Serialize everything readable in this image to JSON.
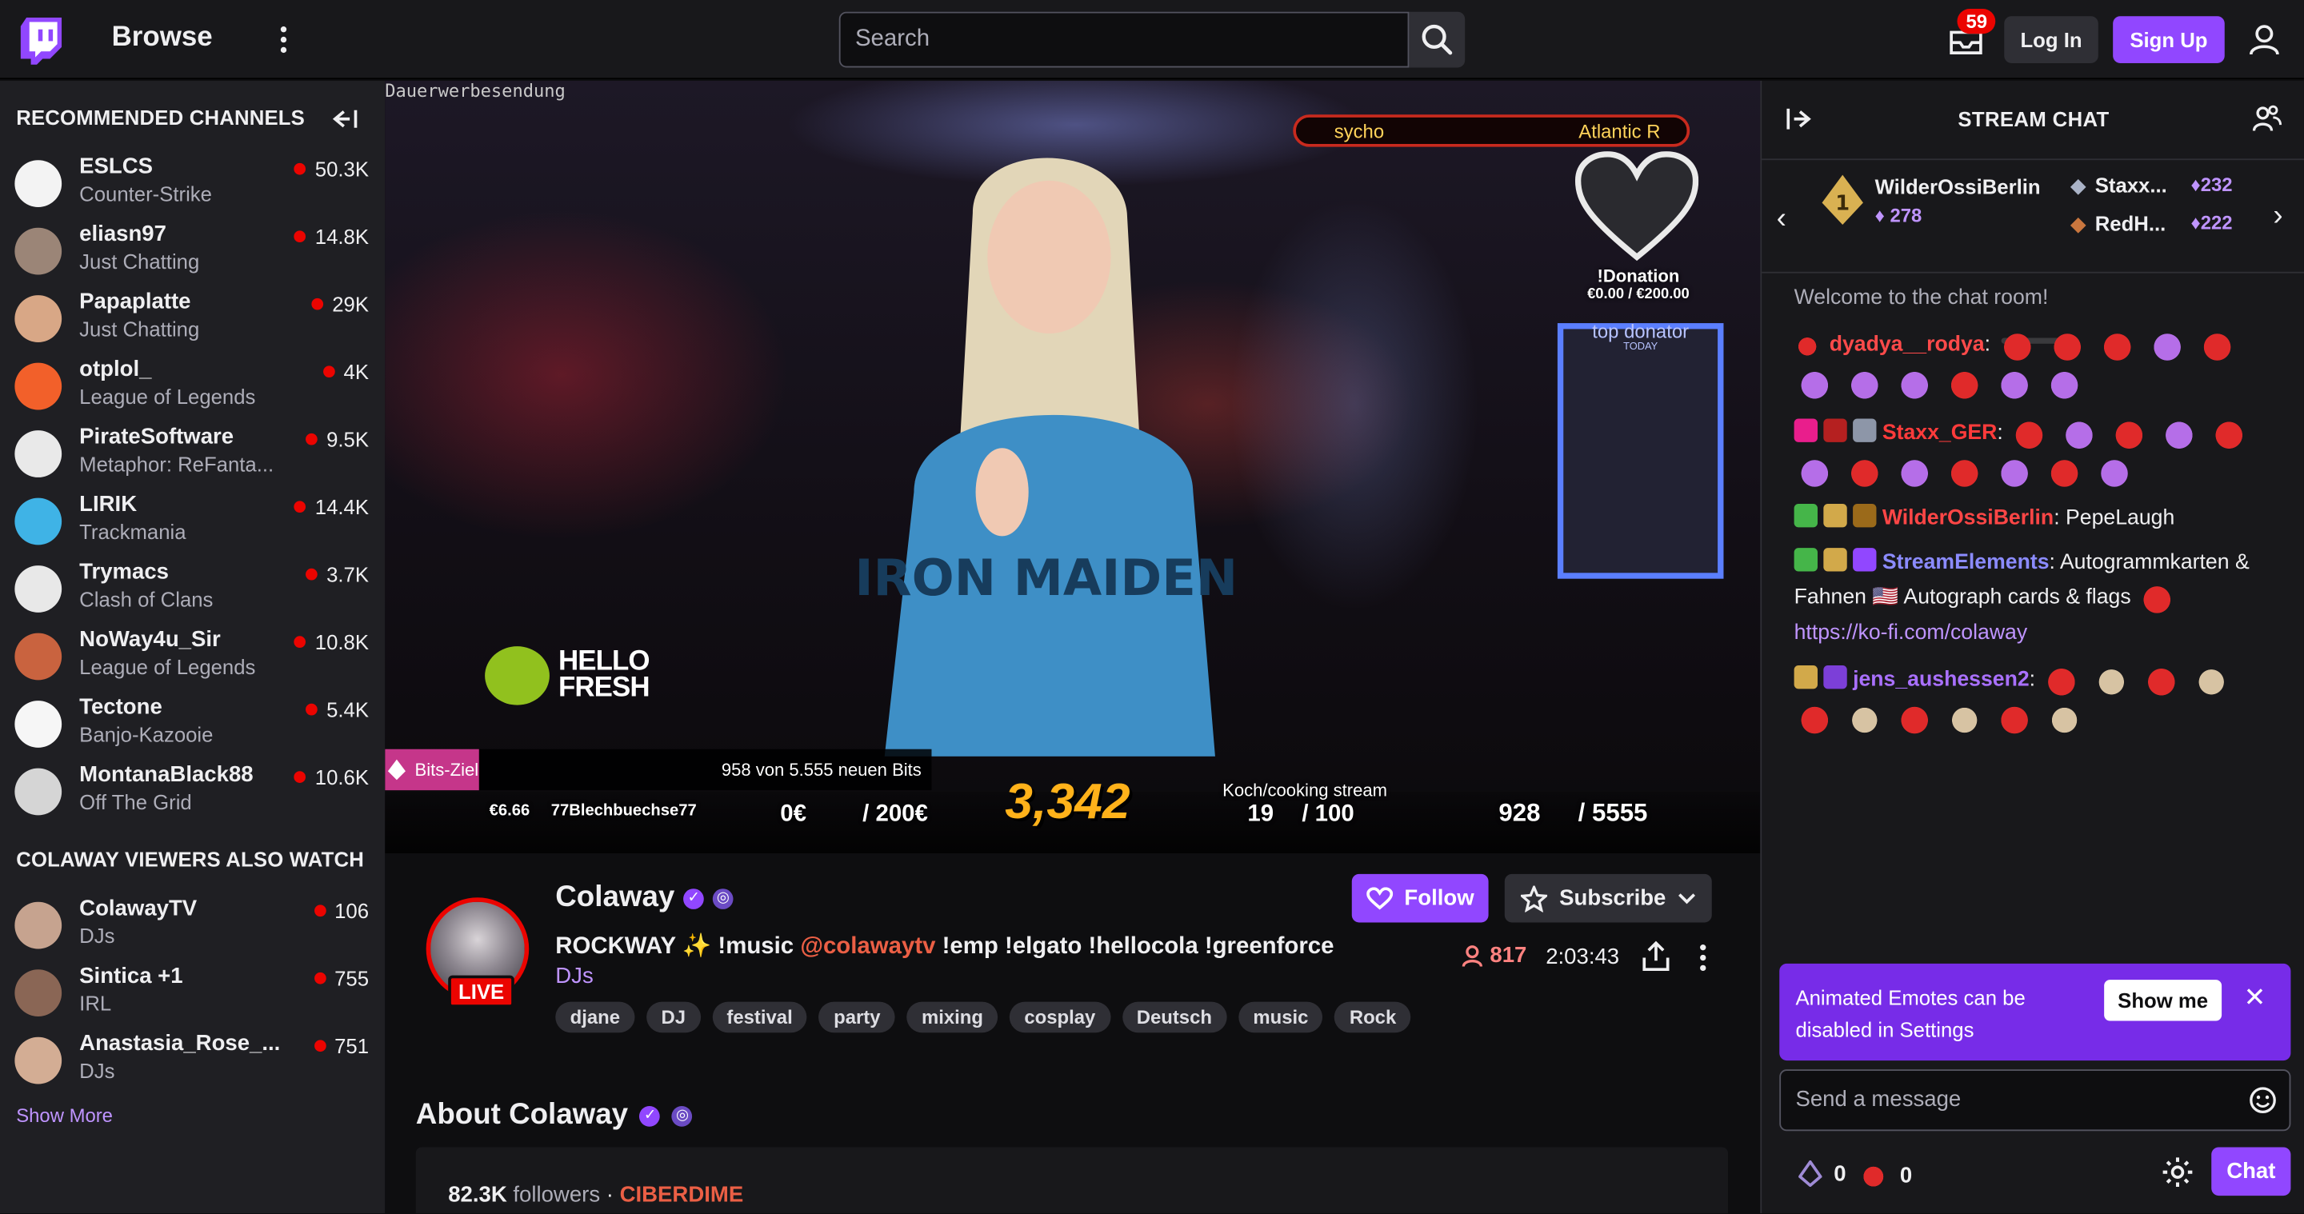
{
  "nav": {
    "browse": "Browse",
    "search_placeholder": "Search",
    "inbox_count": "59",
    "login": "Log In",
    "signup": "Sign Up",
    "brand_color": "#9147ff"
  },
  "sidebar": {
    "recommended_heading": "RECOMMENDED CHANNELS",
    "also_watch_heading": "COLAWAY VIEWERS ALSO WATCH",
    "show_more": "Show More",
    "recommended": [
      {
        "name": "ESLCS",
        "game": "Counter-Strike",
        "viewers": "50.3K",
        "color": "#f3f3f3"
      },
      {
        "name": "eliasn97",
        "game": "Just Chatting",
        "viewers": "14.8K",
        "color": "#9b8577"
      },
      {
        "name": "Papaplatte",
        "game": "Just Chatting",
        "viewers": "29K",
        "color": "#d8a786"
      },
      {
        "name": "otplol_",
        "game": "League of Legends",
        "viewers": "4K",
        "color": "#f2602a"
      },
      {
        "name": "PirateSoftware",
        "game": "Metaphor: ReFanta...",
        "viewers": "9.5K",
        "color": "#e9e9e9"
      },
      {
        "name": "LIRIK",
        "game": "Trackmania",
        "viewers": "14.4K",
        "color": "#3fb3e6"
      },
      {
        "name": "Trymacs",
        "game": "Clash of Clans",
        "viewers": "3.7K",
        "color": "#e8e8e8"
      },
      {
        "name": "NoWay4u_Sir",
        "game": "League of Legends",
        "viewers": "10.8K",
        "color": "#c9633f"
      },
      {
        "name": "Tectone",
        "game": "Banjo-Kazooie",
        "viewers": "5.4K",
        "color": "#f6f6f6"
      },
      {
        "name": "MontanaBlack88",
        "game": "Off The Grid",
        "viewers": "10.6K",
        "color": "#d5d5d5"
      }
    ],
    "also_watch": [
      {
        "name": "ColawayTV",
        "game": "DJs",
        "viewers": "106",
        "color": "#c6a38f"
      },
      {
        "name": "Sintica +1",
        "game": "IRL",
        "viewers": "755",
        "color": "#8a6655"
      },
      {
        "name": "Anastasia_Rose_...",
        "game": "DJs",
        "viewers": "751",
        "color": "#d3ad94"
      }
    ]
  },
  "video": {
    "dauerwerbung": "Dauerwerbesendung",
    "bar_left": "sycho",
    "bar_right": "Atlantic R",
    "donation_title": "!Donation",
    "donation_amount": "€0.00 / €200.00",
    "top_donator": "top donator",
    "today": "TODAY",
    "hellofresh_1": "HELLO",
    "hellofresh_2": "FRESH",
    "bits_label": "Bits-Ziel",
    "bits_progress": "958 von 5.555 neuen Bits",
    "last_donation": "€6.66",
    "last_donor": "77Blechbuechse77",
    "euro_now": "0€",
    "euro_goal": "/ 200€",
    "bits_big": "3,342",
    "koch_label": "Koch/cooking stream",
    "koch_now": "19",
    "koch_goal": "/ 100",
    "bits_now": "928",
    "bits_goal": "/ 5555"
  },
  "channel": {
    "name": "Colaway",
    "live": "LIVE",
    "title_pre": "ROCKWAY ✨ !music ",
    "title_mention": "@colawaytv",
    "title_post": " !emp !elgato !hellocola !greenforce",
    "category": "DJs",
    "tags": [
      "djane",
      "DJ",
      "festival",
      "party",
      "mixing",
      "cosplay",
      "Deutsch",
      "music",
      "Rock"
    ],
    "follow": "Follow",
    "subscribe": "Subscribe",
    "viewers": "817",
    "uptime": "2:03:43",
    "about_heading": "About Colaway",
    "followers_count": "82.3K",
    "followers_label": "followers",
    "team": "CIBERDIME"
  },
  "chat": {
    "title": "STREAM CHAT",
    "leader1_name": "WilderOssiBerlin",
    "leader1_bits": "278",
    "leader1_rank": "1",
    "leader2_name": "Staxx...",
    "leader2_bits": "232",
    "leader3_name": "RedH...",
    "leader3_bits": "222",
    "welcome": "Welcome to the chat room!",
    "messages": [
      {
        "user": "dyadya__rodya",
        "color": "#ff4a4a",
        "text": ""
      },
      {
        "user": "Staxx_GER",
        "color": "#ff3b3b",
        "text": ""
      },
      {
        "user": "WilderOssiBerlin",
        "color": "#ff4646",
        "text": "PepeLaugh"
      },
      {
        "user": "StreamElements",
        "color": "#8b8bff",
        "text": "Autogrammkarten & Fahnen 🇺🇸 Autograph cards & flags"
      },
      {
        "user": "jens_aushessen2",
        "color": "#a970ff",
        "text": ""
      }
    ],
    "link": "https://ko-fi.com/colaway",
    "notice_text": "Animated Emotes can be disabled in Settings",
    "notice_button": "Show me",
    "input_placeholder": "Send a message",
    "bits_balance": "0",
    "points_balance": "0",
    "chat_button": "Chat"
  }
}
